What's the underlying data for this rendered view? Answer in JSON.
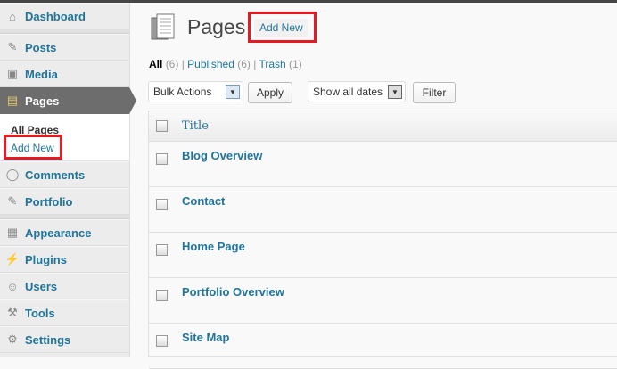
{
  "sidebar": {
    "items": [
      {
        "label": "Dashboard",
        "icon": "home-icon"
      },
      {
        "label": "Posts",
        "icon": "pin-icon"
      },
      {
        "label": "Media",
        "icon": "media-icon"
      },
      {
        "label": "Pages",
        "icon": "pages-icon"
      },
      {
        "label": "Comments",
        "icon": "comment-icon"
      },
      {
        "label": "Portfolio",
        "icon": "pin-icon"
      },
      {
        "label": "Appearance",
        "icon": "appearance-icon"
      },
      {
        "label": "Plugins",
        "icon": "plug-icon"
      },
      {
        "label": "Users",
        "icon": "users-icon"
      },
      {
        "label": "Tools",
        "icon": "tools-icon"
      },
      {
        "label": "Settings",
        "icon": "settings-icon"
      }
    ],
    "submenu": {
      "all_pages": "All Pages",
      "add_new": "Add New"
    }
  },
  "header": {
    "title": "Pages",
    "add_new": "Add New"
  },
  "filters": {
    "all": "All",
    "all_count": "(6)",
    "published": "Published",
    "published_count": "(6)",
    "trash": "Trash",
    "trash_count": "(1)"
  },
  "toolbar": {
    "bulk_actions": "Bulk Actions",
    "apply": "Apply",
    "dates": "Show all dates",
    "filter": "Filter"
  },
  "table": {
    "header": "Title",
    "rows": [
      "Blog Overview",
      "Contact",
      "Home Page",
      "Portfolio Overview",
      "Site Map"
    ]
  },
  "colors": {
    "link": "#21759b",
    "highlight": "#e41b23",
    "active_menu": "#6d6d6d"
  }
}
